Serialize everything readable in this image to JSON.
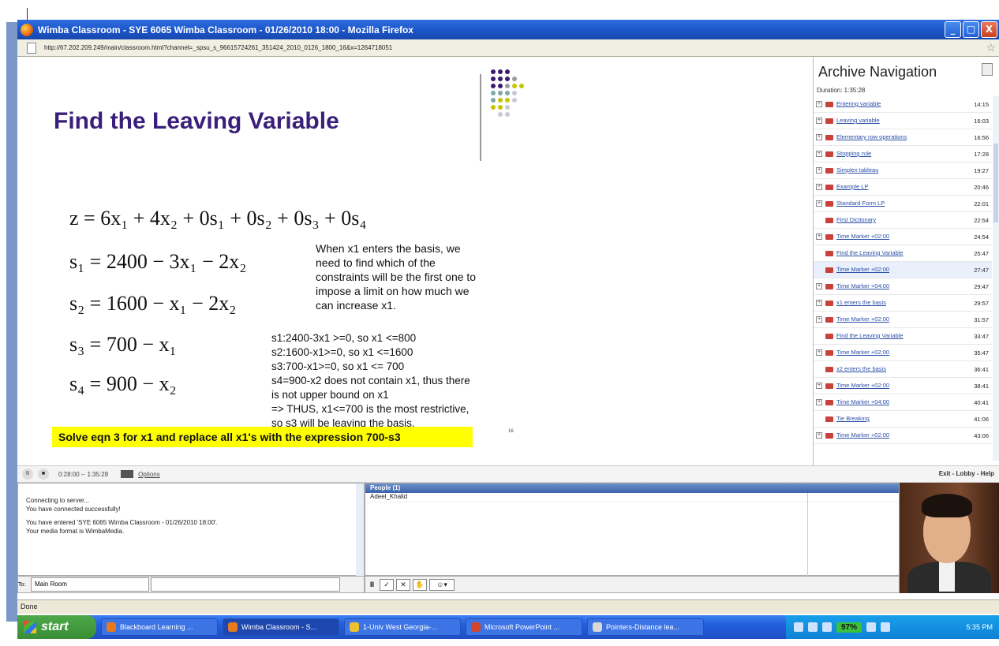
{
  "window": {
    "title": "Wimba Classroom - SYE 6065 Wimba Classroom - 01/26/2010 18:00 - Mozilla Firefox",
    "url": "http://67.202.209.249/main/classroom.html?channel=_spsu_s_96615724261_351424_2010_0126_1800_16&x=1264718051",
    "controls": {
      "minimize": "_",
      "maximize": "□",
      "close": "X"
    }
  },
  "slide": {
    "title": "Find the Leaving Variable",
    "equations": [
      "z = 6x₁ + 4x₂ + 0s₁ + 0s₂ + 0s₃ + 0s₄",
      "s₁ = 2400 − 3x₁ − 2x₂",
      "s₂ = 1600 − x₁ − 2x₂",
      "s₃ = 700 − x₁",
      "s₄ = 900 − x₂"
    ],
    "note_lines": [
      "When x1 enters the basis, we",
      "need to find which of the",
      "constraints will be the first one to",
      "impose a limit on how much we",
      "can increase x1."
    ],
    "calc_lines": [
      "s1:2400-3x1 >=0, so x1 <=800",
      "s2:1600-x1>=0, so x1 <=1600",
      "s3:700-x1>=0, so x1 <= 700",
      "s4=900-x2 does not contain x1, thus there",
      "is not upper bound on x1",
      "=> THUS, x1<=700 is the most restrictive,",
      "so s3 will be leaving the basis."
    ],
    "highlight": "Solve eqn 3 for x1 and replace all x1's with the expression 700-s3",
    "slide_number": "16"
  },
  "archive": {
    "heading": "Archive Navigation",
    "duration": "Duration: 1:35:28",
    "items": [
      {
        "title": "Entering variable",
        "time": "14:15",
        "expandable": true
      },
      {
        "title": "Leaving variable",
        "time": "16:03",
        "expandable": true
      },
      {
        "title": "Elementary row operations",
        "time": "16:56",
        "expandable": true
      },
      {
        "title": "Stopping rule",
        "time": "17:28",
        "expandable": true
      },
      {
        "title": "Simplex tableau",
        "time": "19:27",
        "expandable": true
      },
      {
        "title": "Example LP",
        "time": "20:46",
        "expandable": true
      },
      {
        "title": "Standard Form LP",
        "time": "22:01",
        "expandable": true
      },
      {
        "title": "First Dictionary",
        "time": "22:54",
        "expandable": false
      },
      {
        "title": "Time Marker +02:00",
        "time": "24:54",
        "expandable": true
      },
      {
        "title": "Find the Leaving Variable",
        "time": "25:47",
        "expandable": false
      },
      {
        "title": "Time Marker +02:00",
        "time": "27:47",
        "expandable": false
      },
      {
        "title": "Time Marker +04:00",
        "time": "29:47",
        "expandable": true
      },
      {
        "title": "x1 enters the basis",
        "time": "29:57",
        "expandable": true
      },
      {
        "title": "Time Marker +02:00",
        "time": "31:57",
        "expandable": true
      },
      {
        "title": "Find the Leaving Variable",
        "time": "33:47",
        "expandable": false
      },
      {
        "title": "Time Marker +02:00",
        "time": "35:47",
        "expandable": true
      },
      {
        "title": "x2 enters the basis",
        "time": "36:41",
        "expandable": false
      },
      {
        "title": "Time Marker +02:00",
        "time": "38:41",
        "expandable": true
      },
      {
        "title": "Time Marker +04:00",
        "time": "40:41",
        "expandable": true
      },
      {
        "title": "Tie Breaking",
        "time": "41:06",
        "expandable": false
      },
      {
        "title": "Time Marker +02:00",
        "time": "43:06",
        "expandable": true
      }
    ]
  },
  "playbar": {
    "time": "0:28:00 -- 1:35:28",
    "options_label": "Options",
    "links": "Exit - Lobby - Help"
  },
  "chat": {
    "messages": [
      "Connecting to server...",
      "You have connected successfully!",
      "You have entered 'SYE 6065 Wimba Classroom - 01/26/2010 18:00'.",
      "Your media format is WimbaMedia."
    ],
    "to_label": "To:",
    "room": "Main Room"
  },
  "people": {
    "header": "People (1)",
    "members": [
      "Adeel_Khalid"
    ]
  },
  "status": "Done",
  "taskbar": {
    "start": "start",
    "tasks": [
      "Blackboard Learning ...",
      "Wimba Classroom - S...",
      "1-Univ West Georgia-...",
      "Microsoft PowerPoint ...",
      "Pointers-Distance lea..."
    ],
    "battery": "97%",
    "clock": "5:35 PM"
  }
}
